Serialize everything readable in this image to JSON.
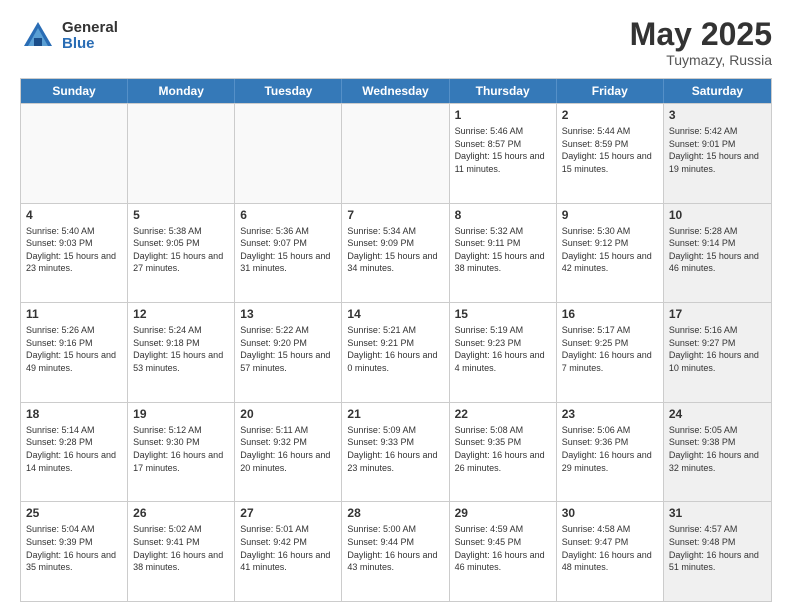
{
  "header": {
    "logo_general": "General",
    "logo_blue": "Blue",
    "title": "May 2025",
    "location": "Tuymazy, Russia"
  },
  "days_of_week": [
    "Sunday",
    "Monday",
    "Tuesday",
    "Wednesday",
    "Thursday",
    "Friday",
    "Saturday"
  ],
  "rows": [
    [
      {
        "day": "",
        "empty": true
      },
      {
        "day": "",
        "empty": true
      },
      {
        "day": "",
        "empty": true
      },
      {
        "day": "",
        "empty": true
      },
      {
        "day": "1",
        "sunrise": "5:46 AM",
        "sunset": "8:57 PM",
        "daylight": "15 hours and 11 minutes."
      },
      {
        "day": "2",
        "sunrise": "5:44 AM",
        "sunset": "8:59 PM",
        "daylight": "15 hours and 15 minutes."
      },
      {
        "day": "3",
        "sunrise": "5:42 AM",
        "sunset": "9:01 PM",
        "daylight": "15 hours and 19 minutes.",
        "shaded": true
      }
    ],
    [
      {
        "day": "4",
        "sunrise": "5:40 AM",
        "sunset": "9:03 PM",
        "daylight": "15 hours and 23 minutes."
      },
      {
        "day": "5",
        "sunrise": "5:38 AM",
        "sunset": "9:05 PM",
        "daylight": "15 hours and 27 minutes."
      },
      {
        "day": "6",
        "sunrise": "5:36 AM",
        "sunset": "9:07 PM",
        "daylight": "15 hours and 31 minutes."
      },
      {
        "day": "7",
        "sunrise": "5:34 AM",
        "sunset": "9:09 PM",
        "daylight": "15 hours and 34 minutes."
      },
      {
        "day": "8",
        "sunrise": "5:32 AM",
        "sunset": "9:11 PM",
        "daylight": "15 hours and 38 minutes."
      },
      {
        "day": "9",
        "sunrise": "5:30 AM",
        "sunset": "9:12 PM",
        "daylight": "15 hours and 42 minutes."
      },
      {
        "day": "10",
        "sunrise": "5:28 AM",
        "sunset": "9:14 PM",
        "daylight": "15 hours and 46 minutes.",
        "shaded": true
      }
    ],
    [
      {
        "day": "11",
        "sunrise": "5:26 AM",
        "sunset": "9:16 PM",
        "daylight": "15 hours and 49 minutes."
      },
      {
        "day": "12",
        "sunrise": "5:24 AM",
        "sunset": "9:18 PM",
        "daylight": "15 hours and 53 minutes."
      },
      {
        "day": "13",
        "sunrise": "5:22 AM",
        "sunset": "9:20 PM",
        "daylight": "15 hours and 57 minutes."
      },
      {
        "day": "14",
        "sunrise": "5:21 AM",
        "sunset": "9:21 PM",
        "daylight": "16 hours and 0 minutes."
      },
      {
        "day": "15",
        "sunrise": "5:19 AM",
        "sunset": "9:23 PM",
        "daylight": "16 hours and 4 minutes."
      },
      {
        "day": "16",
        "sunrise": "5:17 AM",
        "sunset": "9:25 PM",
        "daylight": "16 hours and 7 minutes."
      },
      {
        "day": "17",
        "sunrise": "5:16 AM",
        "sunset": "9:27 PM",
        "daylight": "16 hours and 10 minutes.",
        "shaded": true
      }
    ],
    [
      {
        "day": "18",
        "sunrise": "5:14 AM",
        "sunset": "9:28 PM",
        "daylight": "16 hours and 14 minutes."
      },
      {
        "day": "19",
        "sunrise": "5:12 AM",
        "sunset": "9:30 PM",
        "daylight": "16 hours and 17 minutes."
      },
      {
        "day": "20",
        "sunrise": "5:11 AM",
        "sunset": "9:32 PM",
        "daylight": "16 hours and 20 minutes."
      },
      {
        "day": "21",
        "sunrise": "5:09 AM",
        "sunset": "9:33 PM",
        "daylight": "16 hours and 23 minutes."
      },
      {
        "day": "22",
        "sunrise": "5:08 AM",
        "sunset": "9:35 PM",
        "daylight": "16 hours and 26 minutes."
      },
      {
        "day": "23",
        "sunrise": "5:06 AM",
        "sunset": "9:36 PM",
        "daylight": "16 hours and 29 minutes."
      },
      {
        "day": "24",
        "sunrise": "5:05 AM",
        "sunset": "9:38 PM",
        "daylight": "16 hours and 32 minutes.",
        "shaded": true
      }
    ],
    [
      {
        "day": "25",
        "sunrise": "5:04 AM",
        "sunset": "9:39 PM",
        "daylight": "16 hours and 35 minutes."
      },
      {
        "day": "26",
        "sunrise": "5:02 AM",
        "sunset": "9:41 PM",
        "daylight": "16 hours and 38 minutes."
      },
      {
        "day": "27",
        "sunrise": "5:01 AM",
        "sunset": "9:42 PM",
        "daylight": "16 hours and 41 minutes."
      },
      {
        "day": "28",
        "sunrise": "5:00 AM",
        "sunset": "9:44 PM",
        "daylight": "16 hours and 43 minutes."
      },
      {
        "day": "29",
        "sunrise": "4:59 AM",
        "sunset": "9:45 PM",
        "daylight": "16 hours and 46 minutes."
      },
      {
        "day": "30",
        "sunrise": "4:58 AM",
        "sunset": "9:47 PM",
        "daylight": "16 hours and 48 minutes."
      },
      {
        "day": "31",
        "sunrise": "4:57 AM",
        "sunset": "9:48 PM",
        "daylight": "16 hours and 51 minutes.",
        "shaded": true
      }
    ]
  ]
}
